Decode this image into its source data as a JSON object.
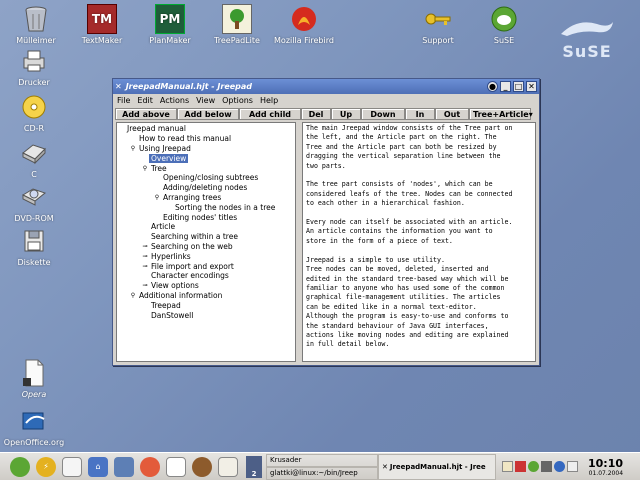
{
  "desktop": {
    "top_icons": [
      {
        "label": "Mülleimer",
        "icon": "trash-icon"
      },
      {
        "label": "TextMaker",
        "icon": "textmaker-icon",
        "badge": "TM"
      },
      {
        "label": "PlanMaker",
        "icon": "planmaker-icon",
        "badge": "PM"
      },
      {
        "label": "TreePadLite",
        "icon": "tree-icon"
      },
      {
        "label": "Mozilla Firebird",
        "icon": "firebird-icon"
      },
      {
        "label": "Support",
        "icon": "key-icon"
      },
      {
        "label": "SuSE",
        "icon": "suse-icon"
      }
    ],
    "left_icons": [
      {
        "label": "Drucker",
        "icon": "printer-icon"
      },
      {
        "label": "CD-R",
        "icon": "cd-icon"
      },
      {
        "label": "C",
        "icon": "drive-icon"
      },
      {
        "label": "DVD-ROM",
        "icon": "dvd-icon"
      },
      {
        "label": "Diskette",
        "icon": "floppy-icon"
      },
      {
        "label": "Opera",
        "icon": "document-icon"
      },
      {
        "label": "OpenOffice.org",
        "icon": "openoffice-icon"
      }
    ],
    "logo_text": "SuSE"
  },
  "window": {
    "title": "JreepadManual.hjt - Jreepad",
    "menu": [
      "File",
      "Edit",
      "Actions",
      "View",
      "Options",
      "Help"
    ],
    "toolbar": {
      "add_above": "Add above",
      "add_below": "Add below",
      "add_child": "Add child",
      "del": "Del",
      "up": "Up",
      "down": "Down",
      "in": "In",
      "out": "Out",
      "view_mode": "Tree+Article"
    },
    "tree": [
      {
        "label": "Jreepad manual",
        "level": 0,
        "handle": ""
      },
      {
        "label": "How to read this manual",
        "level": 1,
        "handle": ""
      },
      {
        "label": "Using Jreepad",
        "level": 1,
        "handle": "o"
      },
      {
        "label": "Overview",
        "level": 2,
        "handle": "",
        "selected": true
      },
      {
        "label": "Tree",
        "level": 2,
        "handle": "o"
      },
      {
        "label": "Opening/closing subtrees",
        "level": 3,
        "handle": ""
      },
      {
        "label": "Adding/deleting nodes",
        "level": 3,
        "handle": ""
      },
      {
        "label": "Arranging trees",
        "level": 3,
        "handle": "o"
      },
      {
        "label": "Sorting the nodes in a tree",
        "level": 4,
        "handle": ""
      },
      {
        "label": "Editing nodes' titles",
        "level": 3,
        "handle": ""
      },
      {
        "label": "Article",
        "level": 2,
        "handle": ""
      },
      {
        "label": "Searching within a tree",
        "level": 2,
        "handle": ""
      },
      {
        "label": "Searching on the web",
        "level": 2,
        "handle": "o-"
      },
      {
        "label": "Hyperlinks",
        "level": 2,
        "handle": "o-"
      },
      {
        "label": "File import and export",
        "level": 2,
        "handle": "o-"
      },
      {
        "label": "Character encodings",
        "level": 2,
        "handle": ""
      },
      {
        "label": "View options",
        "level": 2,
        "handle": "o-"
      },
      {
        "label": "Additional information",
        "level": 1,
        "handle": "o"
      },
      {
        "label": "Treepad",
        "level": 2,
        "handle": ""
      },
      {
        "label": "DanStowell",
        "level": 2,
        "handle": ""
      }
    ],
    "article": "The main Jreepad window consists of the Tree part on\nthe left, and the Article part on the right. The\nTree and the Article part can both be resized by\ndragging the vertical separation line between the\ntwo parts.\n\nThe tree part consists of 'nodes', which can be\nconsidered leafs of the tree. Nodes can be connected\nto each other in a hierarchical fashion.\n\nEvery node can itself be associated with an article.\nAn article contains the information you want to\nstore in the form of a piece of text.\n\nJreepad is a simple to use utility.\nTree nodes can be moved, deleted, inserted and\nedited in the standard tree-based way which will be\nfamiliar to anyone who has used some of the common\ngraphical file-management utilities. The articles\ncan be edited like in a normal text-editor.\nAlthough the program is easy-to-use and conforms to\nthe standard behaviour of Java GUI interfaces,\nactions like moving nodes and editing are explained\nin full detail below."
  },
  "taskbar": {
    "pager_label": "2",
    "tasks": [
      {
        "label": "Krusader",
        "active": false
      },
      {
        "label": "JreepadManual.hjt - Jree",
        "active": true
      },
      {
        "label": "glattki@linux:~/bin/Jreep",
        "active": false
      }
    ],
    "clock": {
      "time": "10:10",
      "date": "01.07.2004"
    }
  }
}
